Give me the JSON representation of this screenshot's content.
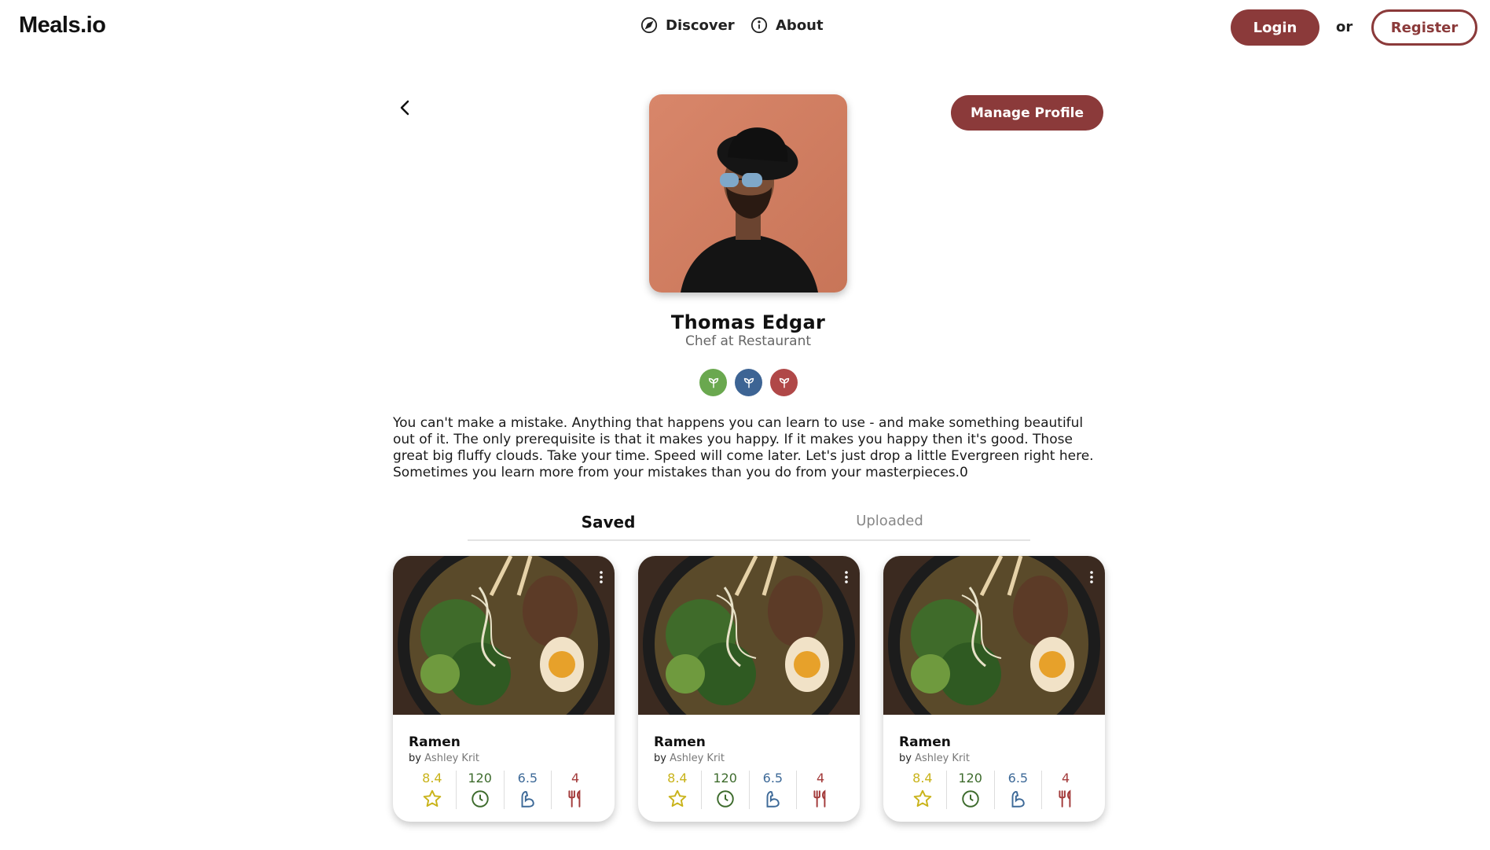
{
  "header": {
    "logo": "Meals.io",
    "nav": {
      "discover": "Discover",
      "about": "About"
    },
    "login_label": "Login",
    "or_text": "or",
    "register_label": "Register"
  },
  "profile": {
    "manage_label": "Manage Profile",
    "name": "Thomas Edgar",
    "role": "Chef at Restaurant",
    "badges": [
      {
        "icon": "leaf-icon",
        "color": "#6aa84f"
      },
      {
        "icon": "leaf-icon",
        "color": "#3d6494"
      },
      {
        "icon": "leaf-icon",
        "color": "#b04848"
      }
    ],
    "bio": "You can't make a mistake. Anything that happens you can learn to use - and make something beautiful out of it. The only prerequisite is that it makes you happy. If it makes you happy then it's good. Those great big fluffy clouds. Take your time. Speed will come later. Let's just drop a little Evergreen right here. Sometimes you learn more from your mistakes than you do from your masterpieces.0"
  },
  "tabs": [
    {
      "label": "Saved",
      "active": true
    },
    {
      "label": "Uploaded",
      "active": false
    }
  ],
  "cards": [
    {
      "title": "Ramen",
      "by": "by",
      "author": "Ashley Krit",
      "rating": "8.4",
      "time": "120",
      "difficulty": "6.5",
      "servings": "4"
    },
    {
      "title": "Ramen",
      "by": "by",
      "author": "Ashley Krit",
      "rating": "8.4",
      "time": "120",
      "difficulty": "6.5",
      "servings": "4"
    },
    {
      "title": "Ramen",
      "by": "by",
      "author": "Ashley Krit",
      "rating": "8.4",
      "time": "120",
      "difficulty": "6.5",
      "servings": "4"
    }
  ],
  "colors": {
    "brand": "#8b3a3a",
    "rating": "#c9b31a",
    "time": "#3d6b2c",
    "difficulty": "#3e6a98",
    "servings": "#a33b3b"
  }
}
